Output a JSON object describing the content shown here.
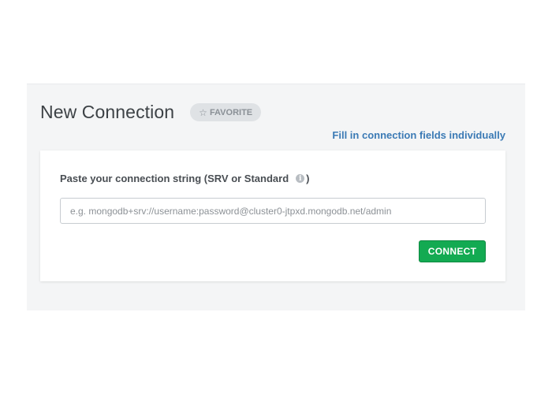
{
  "header": {
    "title": "New Connection",
    "favorite_label": "FAVORITE",
    "favorite_icon": "star-outline-icon"
  },
  "fill_link": "Fill in connection fields individually",
  "form": {
    "label_text": "Paste your connection string (SRV or Standard",
    "label_close": ")",
    "info_icon": "i",
    "input_value": "",
    "input_placeholder": "e.g. mongodb+srv://username:password@cluster0-jtpxd.mongodb.net/admin",
    "connect_label": "CONNECT"
  },
  "colors": {
    "accent_green": "#13aa52",
    "link_blue": "#3b7ab5",
    "panel_bg": "#f4f5f6"
  }
}
